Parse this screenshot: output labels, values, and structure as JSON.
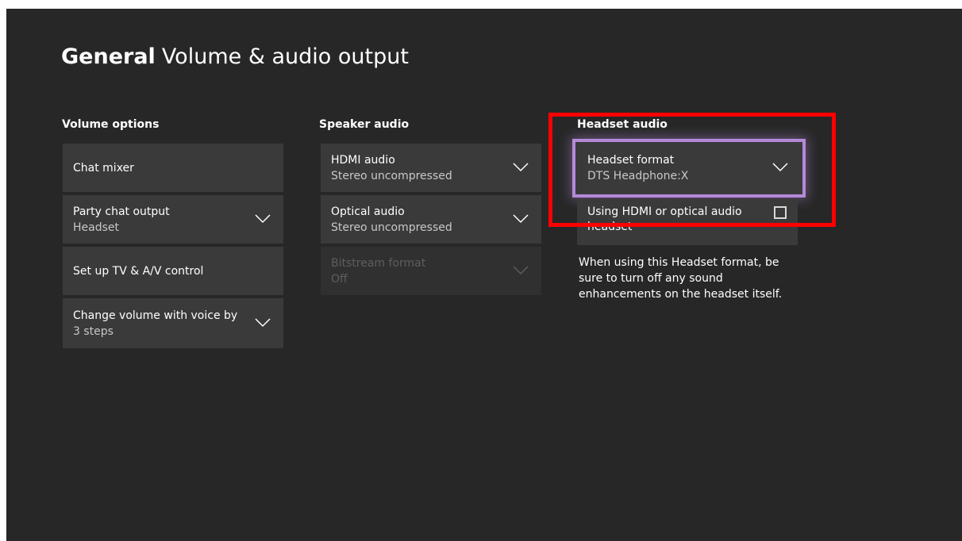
{
  "header": {
    "section": "General",
    "page": "Volume & audio output"
  },
  "volume_options": {
    "heading": "Volume options",
    "chat_mixer": {
      "label": "Chat mixer"
    },
    "party_chat_output": {
      "label": "Party chat output",
      "value": "Headset"
    },
    "tv_av_control": {
      "label": "Set up TV & A/V control"
    },
    "voice_volume": {
      "label": "Change volume with voice by",
      "value": "3 steps"
    }
  },
  "speaker_audio": {
    "heading": "Speaker audio",
    "hdmi_audio": {
      "label": "HDMI audio",
      "value": "Stereo uncompressed"
    },
    "optical_audio": {
      "label": "Optical audio",
      "value": "Stereo uncompressed"
    },
    "bitstream_format": {
      "label": "Bitstream format",
      "value": "Off",
      "enabled": false
    }
  },
  "headset_audio": {
    "heading": "Headset audio",
    "headset_format": {
      "label": "Headset format",
      "value": "DTS Headphone:X",
      "focused": true
    },
    "hdmi_optical_headset": {
      "label": "Using HDMI or optical audio headset",
      "checked": false
    },
    "note": "When using this Headset format, be sure to turn off any sound enhancements on the headset itself."
  },
  "colors": {
    "background": "#272727",
    "tile": "#3a3a3a",
    "focus_outline": "#b489d9",
    "annotation": "#ff0000"
  }
}
